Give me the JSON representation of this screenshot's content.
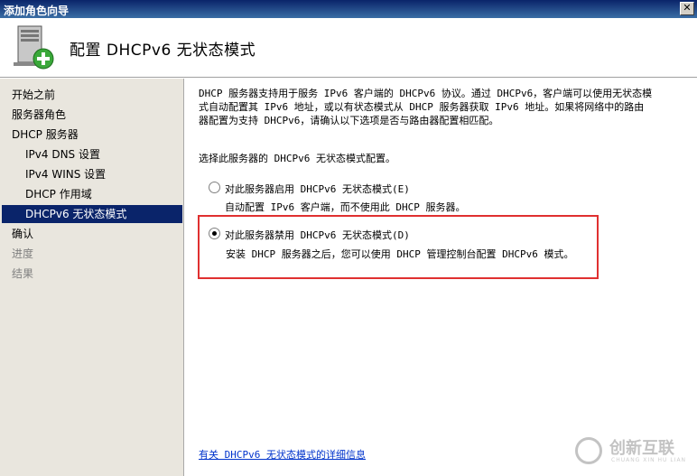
{
  "window": {
    "title": "添加角色向导",
    "close_glyph": "✕"
  },
  "header": {
    "title": "配置 DHCPv6 无状态模式",
    "icon": "server-add-icon"
  },
  "sidebar": {
    "items": [
      {
        "label": "开始之前",
        "level": 0,
        "state": "normal"
      },
      {
        "label": "服务器角色",
        "level": 0,
        "state": "normal"
      },
      {
        "label": "DHCP 服务器",
        "level": 0,
        "state": "normal"
      },
      {
        "label": "IPv4 DNS 设置",
        "level": 1,
        "state": "normal"
      },
      {
        "label": "IPv4 WINS 设置",
        "level": 1,
        "state": "normal"
      },
      {
        "label": "DHCP 作用域",
        "level": 1,
        "state": "normal"
      },
      {
        "label": "DHCPv6 无状态模式",
        "level": 1,
        "state": "selected"
      },
      {
        "label": "确认",
        "level": 0,
        "state": "normal"
      },
      {
        "label": "进度",
        "level": 0,
        "state": "disabled"
      },
      {
        "label": "结果",
        "level": 0,
        "state": "disabled"
      }
    ]
  },
  "main": {
    "description_line1": "DHCP 服务器支持用于服务 IPv6 客户端的 DHCPv6 协议。通过 DHCPv6，客户端可以使用无状态模",
    "description_line2": "式自动配置其 IPv6 地址，或以有状态模式从 DHCP 服务器获取 IPv6 地址。如果将网络中的路由",
    "description_line3": "器配置为支持 DHCPv6，请确认以下选项是否与路由器配置相匹配。",
    "prompt": "选择此服务器的 DHCPv6 无状态模式配置。",
    "options": [
      {
        "label": "对此服务器启用 DHCPv6 无状态模式(E)",
        "sub": "自动配置 IPv6 客户端，而不使用此 DHCP 服务器。",
        "checked": false
      },
      {
        "label": "对此服务器禁用 DHCPv6 无状态模式(D)",
        "sub": "安装 DHCP 服务器之后，您可以使用 DHCP 管理控制台配置 DHCPv6 模式。",
        "checked": true
      }
    ],
    "more_info_link": "有关 DHCPv6 无状态模式的详细信息"
  },
  "watermark": {
    "text": "创新互联",
    "sub": "CHUANG XIN HU LIAN"
  },
  "colors": {
    "selection": "#0a246a",
    "highlight_box": "#e03030",
    "link": "#0033cc"
  }
}
